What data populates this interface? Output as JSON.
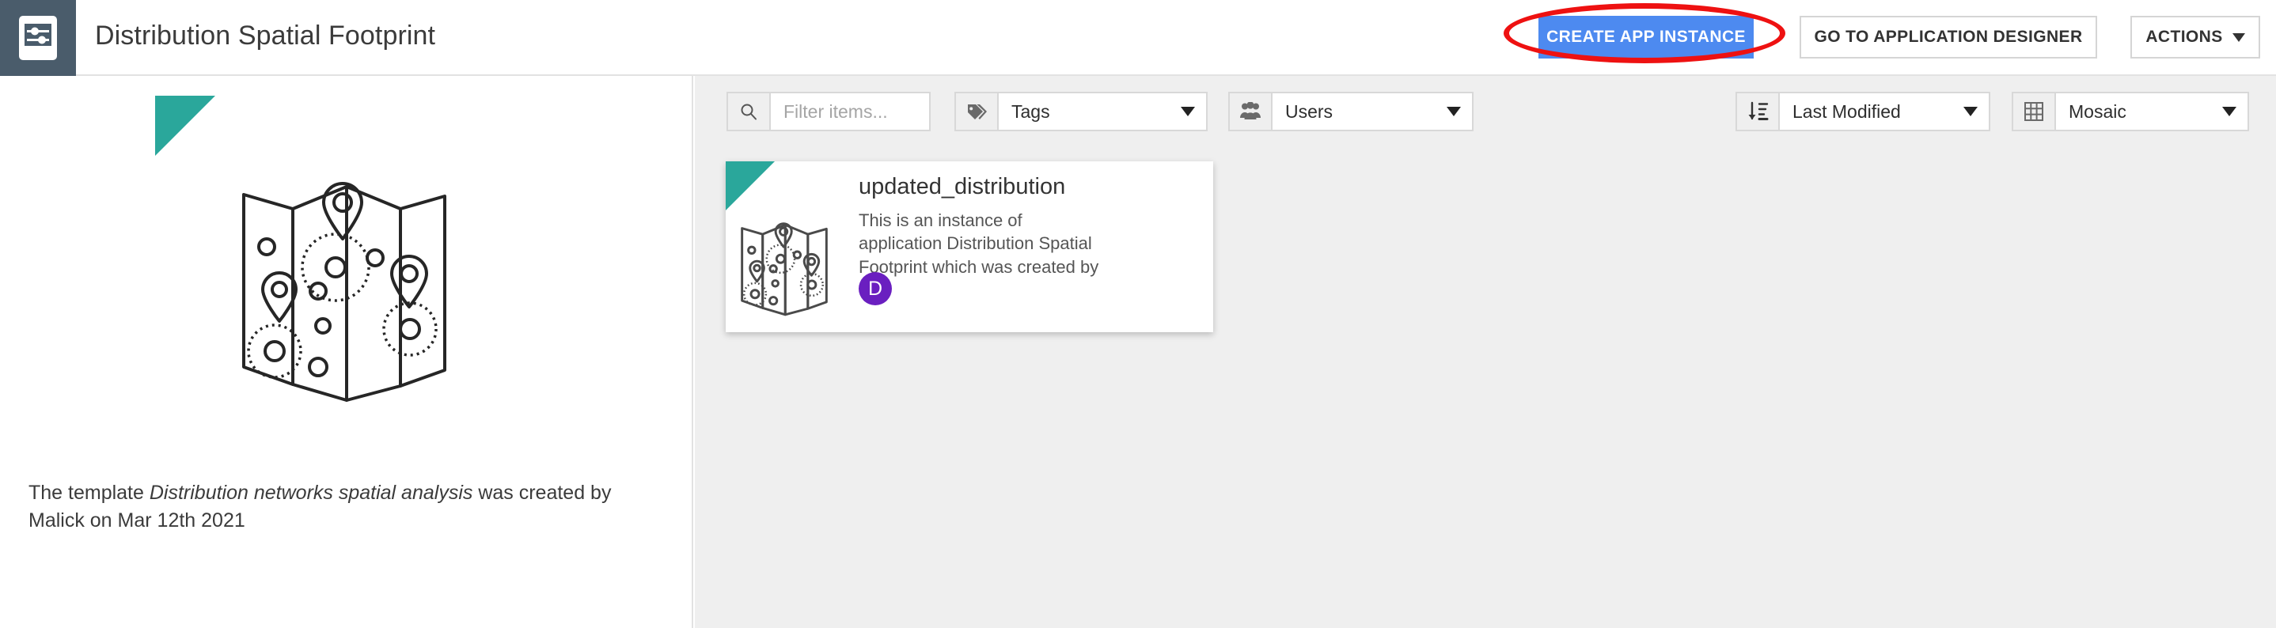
{
  "header": {
    "app_icon": "sliders-icon",
    "title": "Distribution Spatial Footprint",
    "buttons": {
      "create": "CREATE APP INSTANCE",
      "designer": "GO TO APPLICATION DESIGNER",
      "actions": "ACTIONS"
    },
    "accent_blue": "#4d8af0",
    "icon_tile_color": "#4a5c6b"
  },
  "annotation": {
    "shape": "ellipse",
    "color": "#ee1111",
    "targets": "CREATE APP INSTANCE"
  },
  "left_panel": {
    "flag_icon": "bird-icon",
    "flag_color": "#2aa79b",
    "illustration": "folded-map-icon",
    "caption_prefix": "The template ",
    "template_name": "Distribution networks spatial analysis",
    "caption_suffix": " was created by Malick on Mar 12th 2021"
  },
  "toolbar": {
    "search": {
      "icon": "search-icon",
      "value": "",
      "placeholder": "Filter items..."
    },
    "tags": {
      "icon": "tag-icon",
      "value": "Tags"
    },
    "users": {
      "icon": "users-icon",
      "value": "Users"
    },
    "sort": {
      "icon": "sort-descending-icon",
      "value": "Last Modified"
    },
    "view": {
      "icon": "grid-icon",
      "value": "Mosaic"
    }
  },
  "instance_card": {
    "flag_icon": "bird-icon",
    "thumbnail": "folded-map-icon",
    "title": "updated_distribution",
    "description": "This is an instance of application Distribution Spatial Footprint which was created by",
    "avatar_initial": "D",
    "avatar_color": "#6a1fc0"
  }
}
